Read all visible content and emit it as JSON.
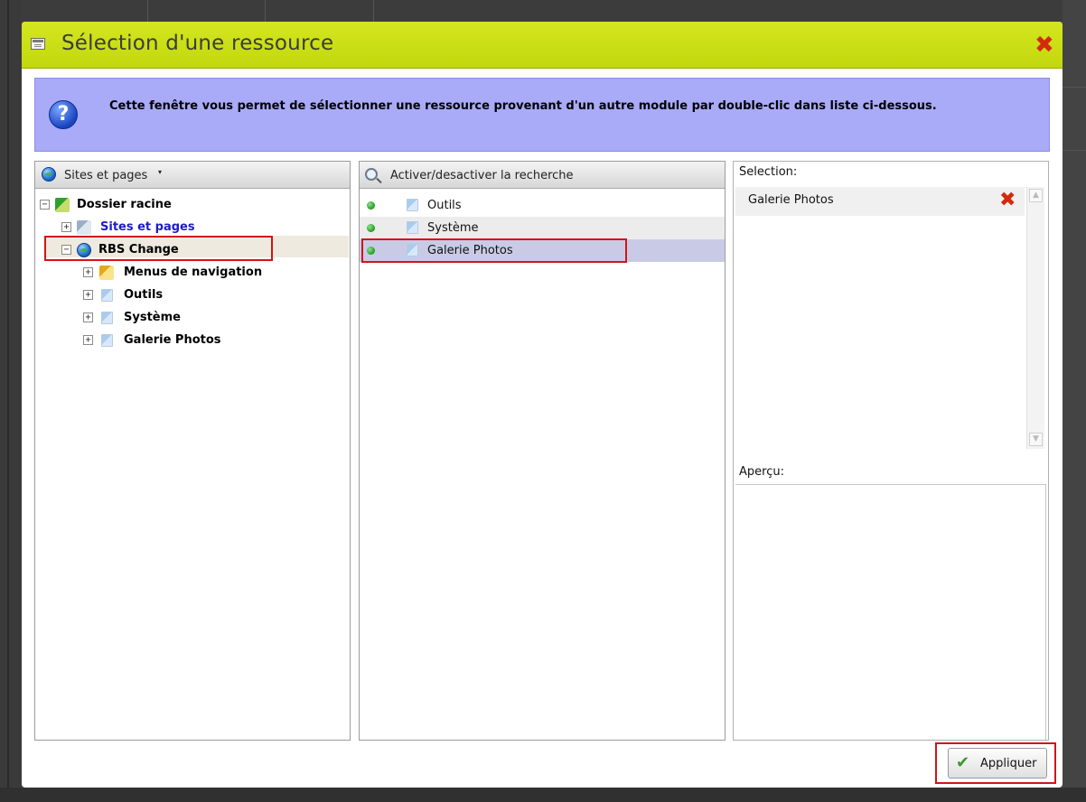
{
  "dialog": {
    "title": "Sélection d'une ressource",
    "info_message": "Cette fenêtre vous permet de sélectionner une ressource provenant d'un autre module par double-clic dans liste ci-dessous."
  },
  "tree_panel": {
    "header_label": "Sites et pages",
    "nodes": [
      {
        "label": "Dossier racine",
        "toggle": "−"
      },
      {
        "label": "Sites et pages",
        "toggle": "+"
      },
      {
        "label": "RBS Change",
        "toggle": "−"
      },
      {
        "label": "Menus de navigation",
        "toggle": "+"
      },
      {
        "label": "Outils",
        "toggle": "+"
      },
      {
        "label": "Système",
        "toggle": "+"
      },
      {
        "label": "Galerie Photos",
        "toggle": "+"
      }
    ]
  },
  "list_panel": {
    "header_label": "Activer/desactiver la recherche",
    "items": [
      {
        "label": "Outils"
      },
      {
        "label": "Système"
      },
      {
        "label": "Galerie Photos"
      }
    ]
  },
  "selection_panel": {
    "selection_label": "Selection:",
    "selected_items": [
      {
        "label": "Galerie Photos"
      }
    ],
    "preview_label": "Aperçu:"
  },
  "footer": {
    "apply_label": "Appliquer"
  },
  "colors": {
    "title_bar": "#c8dc14",
    "info_bg": "#a9aaf8",
    "highlight_box": "#d01515",
    "selected_row": "#c9cbe6"
  }
}
